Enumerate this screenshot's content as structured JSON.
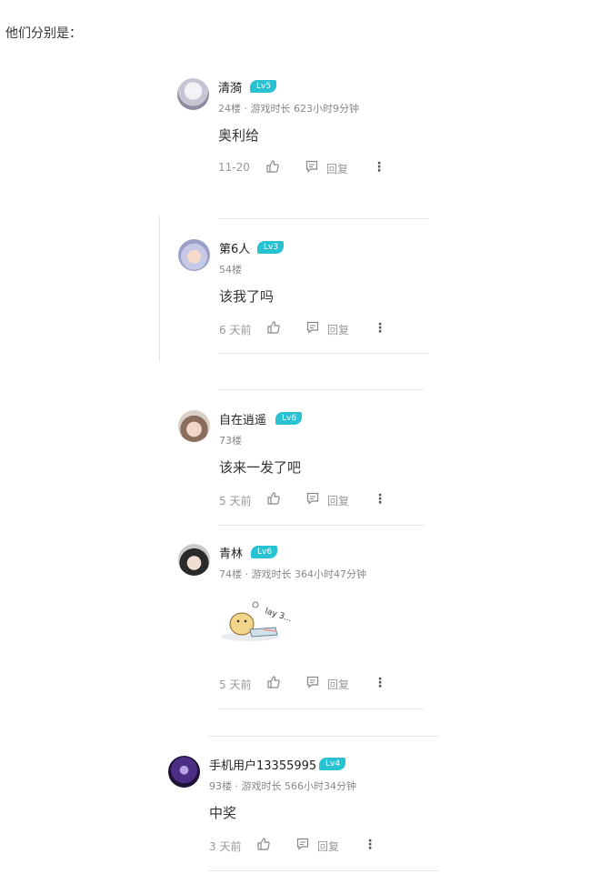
{
  "intro": "他们分别是：",
  "actions_labels": {
    "reply": "回复"
  },
  "comments": [
    {
      "name": "清漪",
      "level": "Lv5",
      "meta": "24楼 · 游戏时长 623小时9分钟",
      "content": "奥利给",
      "time": "11-20"
    },
    {
      "name": "第6人",
      "level": "Lv3",
      "meta": "54楼",
      "content": "该我了吗",
      "time": "6 天前"
    },
    {
      "name": "自在逍遥",
      "level": "Lv6",
      "meta": "73楼",
      "content": "该来一发了吧",
      "time": "5 天前"
    },
    {
      "name": "青林",
      "level": "Lv6",
      "meta": "74楼 · 游戏时长 364小时47分钟",
      "sticker_text": "lay 3...",
      "time": "5 天前"
    },
    {
      "name": "手机用户13355995",
      "level": "Lv4",
      "meta": "93楼 · 游戏时长 566小时34分钟",
      "content": "中奖",
      "time": "3 天前"
    }
  ],
  "icons": {
    "like": "thumbs-up-icon",
    "reply": "comment-icon",
    "more": "more-vertical-icon"
  },
  "colors": {
    "level_badge": "#28c2d2",
    "divider": "#e6e6e6"
  }
}
